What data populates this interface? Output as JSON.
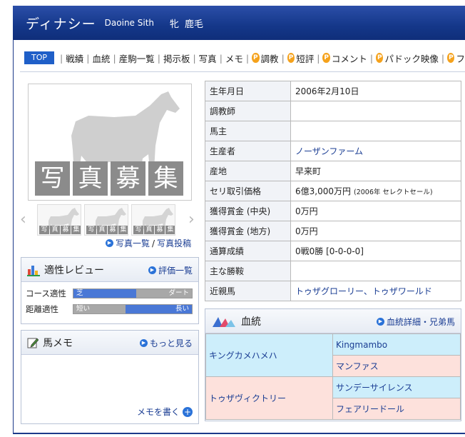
{
  "header": {
    "name": "ディナシー",
    "name_en": "Daoine Sith",
    "sex": "牝",
    "coat": "鹿毛"
  },
  "nav": {
    "top": "TOP",
    "items": [
      "戦績",
      "血統",
      "産駒一覧",
      "掲示板",
      "写真",
      "メモ"
    ],
    "premium_items": [
      "調教",
      "短評",
      "コメント",
      "パドック映像",
      "フ"
    ],
    "premium_icon": "P"
  },
  "photo": {
    "placeholder_chars": [
      "写",
      "真",
      "募",
      "集"
    ],
    "link_list": "写真一覧",
    "link_sep": "/",
    "link_post": "写真投稿"
  },
  "review": {
    "title": "適性レビュー",
    "link": "評価一覧",
    "rows": [
      {
        "label": "コース適性",
        "left": "芝",
        "right": "ダート",
        "left_fraction": 0.53
      },
      {
        "label": "距離適性",
        "left": "短い",
        "right": "長い",
        "left_fraction": 0.44
      }
    ],
    "colors": {
      "blue": "#4a78d6",
      "gray": "#a8a8a8"
    }
  },
  "memo": {
    "title": "馬メモ",
    "link": "もっと見る",
    "write": "メモを書く"
  },
  "info": [
    {
      "k": "生年月日",
      "v": "2006年2月10日"
    },
    {
      "k": "調教師",
      "v": ""
    },
    {
      "k": "馬主",
      "v": ""
    },
    {
      "k": "生産者",
      "v": "ノーザンファーム",
      "link": true
    },
    {
      "k": "産地",
      "v": "早来町"
    },
    {
      "k": "セリ取引価格",
      "v": "6億3,000万円",
      "note": "(2006年 セレクトセール)"
    },
    {
      "k": "獲得賞金 (中央)",
      "v": "0万円"
    },
    {
      "k": "獲得賞金 (地方)",
      "v": "0万円"
    },
    {
      "k": "通算成績",
      "v": "0戦0勝 [0-0-0-0]"
    },
    {
      "k": "主な勝鞍",
      "v": ""
    },
    {
      "k": "近親馬",
      "v": "トゥザグローリー、トゥザワールド",
      "link": true
    }
  ],
  "pedigree": {
    "title": "血統",
    "link": "血統詳細・兄弟馬",
    "sire": "キングカメハメハ",
    "sire_sire": "Kingmambo",
    "sire_dam": "マンファス",
    "dam": "トゥザヴィクトリー",
    "dam_sire": "サンデーサイレンス",
    "dam_dam": "フェアリードール",
    "colors": {
      "sire_bg": "#cdeefb",
      "dam_bg": "#fde1dc"
    }
  }
}
